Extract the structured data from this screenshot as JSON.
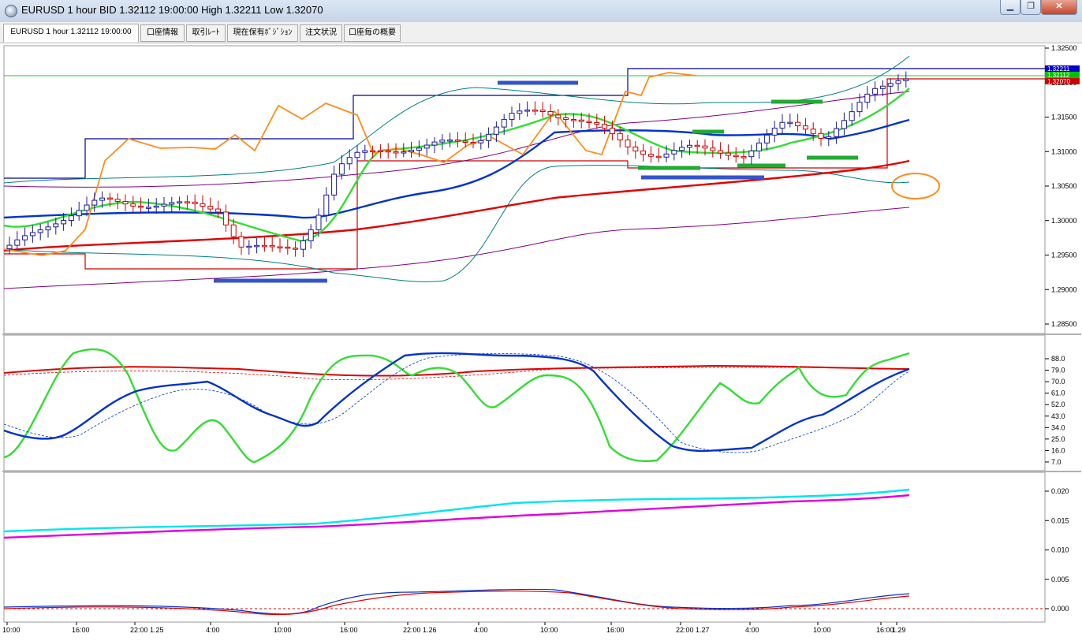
{
  "window": {
    "title": "EURUSD 1 hour BID 1.32112 19:00:00 High 1.32211 Low 1.32070",
    "min_glyph": "▁",
    "max_glyph": "❐",
    "close_glyph": "✕"
  },
  "tabs": [
    {
      "label": "EURUSD 1 hour 1.32112 19:00:00",
      "active": true
    },
    {
      "label": "口座情報",
      "active": false
    },
    {
      "label": "取引ﾚｰﾄ",
      "active": false
    },
    {
      "label": "現在保有ﾎﾟｼﾞｼｮﾝ",
      "active": false
    },
    {
      "label": "注文状況",
      "active": false
    },
    {
      "label": "口座毎の概要",
      "active": false
    }
  ],
  "price_axis": {
    "labels": [
      "1.32500",
      "1.32000",
      "1.31500",
      "1.31000",
      "1.30500",
      "1.30000",
      "1.29500",
      "1.29000",
      "1.28500"
    ],
    "current_labels": [
      "1.32211",
      "1.32112",
      "1.32070"
    ],
    "current_colors": [
      "#0000cc",
      "#00c000",
      "#cc0000"
    ]
  },
  "stoch_axis": {
    "labels": [
      "88.0",
      "79.0",
      "70.0",
      "61.0",
      "52.0",
      "43.0",
      "34.0",
      "25.0",
      "16.0",
      "7.0"
    ]
  },
  "lower_axis": {
    "labels": [
      "0.020",
      "0.015",
      "0.010",
      "0.005",
      "0.000"
    ]
  },
  "time_axis": {
    "labels": [
      "10:00",
      "16:00",
      "22:00 1.25",
      "4:00",
      "10:00",
      "16:00",
      "22:00 1.26",
      "4:00",
      "10:00",
      "16:00",
      "22:00 1.27",
      "4:00",
      "10:00",
      "16:00",
      "1.29"
    ]
  },
  "colors": {
    "bb_outer": "#800080",
    "bb_inner": "#007f7f",
    "ma_long": "#e00000",
    "ma_mid": "#0033cc",
    "ma_short": "#33dd33",
    "ichimoku_span": "#ff8c1a",
    "range_box_high": "#000099",
    "range_box_low": "#cc0000",
    "cyan_line": "#00e5ee",
    "magenta_line": "#e000e0",
    "highlight_circle": "#ff8c1a",
    "marker_blue": "#3355cc",
    "marker_green": "#22aa33"
  }
}
